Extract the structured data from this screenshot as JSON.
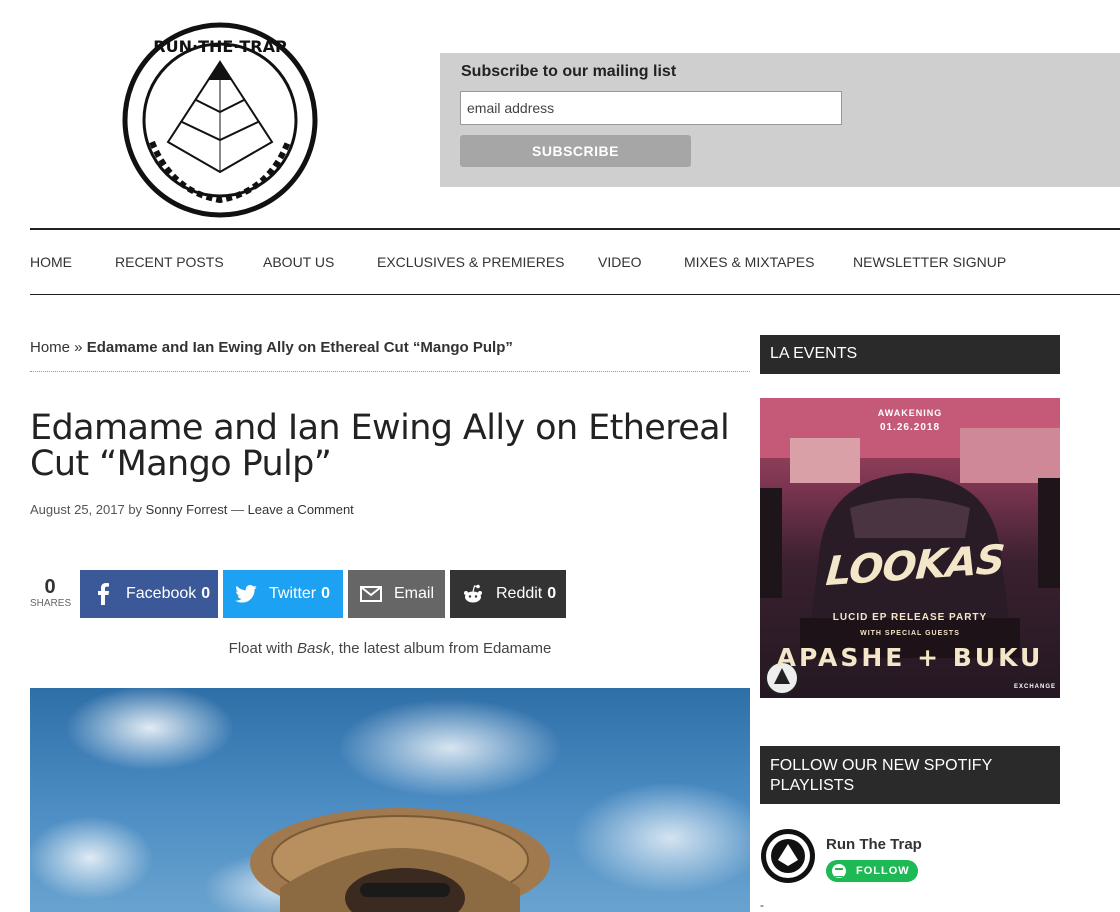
{
  "logo": {
    "text": "RUN·THE·TRAP"
  },
  "subscribe": {
    "title": "Subscribe to our mailing list",
    "email_placeholder": "email address",
    "button_label": "SUBSCRIBE"
  },
  "nav": {
    "items": [
      {
        "label": "HOME"
      },
      {
        "label": "RECENT POSTS"
      },
      {
        "label": "ABOUT US"
      },
      {
        "label": "EXCLUSIVES & PREMIERES"
      },
      {
        "label": "VIDEO"
      },
      {
        "label": "MIXES & MIXTAPES"
      },
      {
        "label": "NEWSLETTER SIGNUP"
      }
    ]
  },
  "breadcrumb": {
    "home": "Home",
    "separator": " » ",
    "current": "Edamame and Ian Ewing Ally on Ethereal Cut “Mango Pulp”"
  },
  "article": {
    "title": "Edamame and Ian Ewing Ally on Ethereal Cut “Mango Pulp”",
    "date": "August 25, 2017",
    "by": " by ",
    "author": "Sonny Forrest",
    "dash": " — ",
    "comments": "Leave a Comment",
    "caption_before": "Float with ",
    "caption_em": "Bask",
    "caption_after": ", the latest album from Edamame"
  },
  "share": {
    "total": "0",
    "total_label": "SHARES",
    "buttons": [
      {
        "label": "Facebook",
        "count": "0",
        "icon": "facebook-icon",
        "color": "#3b5998"
      },
      {
        "label": "Twitter",
        "count": "0",
        "icon": "twitter-icon",
        "color": "#1da1f2"
      },
      {
        "label": "Email",
        "count": "",
        "icon": "email-icon",
        "color": "#666666"
      },
      {
        "label": "Reddit",
        "count": "0",
        "icon": "reddit-icon",
        "color": "#333333"
      }
    ]
  },
  "sidebar": {
    "events_title": "LA EVENTS",
    "event_poster": {
      "header": "AWAKENING",
      "date": "01.26.2018",
      "headline": "LOOKAS",
      "subtitle": "LUCID EP RELEASE PARTY",
      "guests_label": "WITH SPECIAL GUESTS",
      "artists": "APASHE + BUKU",
      "venue": "EXCHANGE"
    },
    "spotify_title": "FOLLOW OUR NEW SPOTIFY PLAYLISTS",
    "spotify_name": "Run The Trap",
    "follow_label": "FOLLOW",
    "dash": "-"
  }
}
